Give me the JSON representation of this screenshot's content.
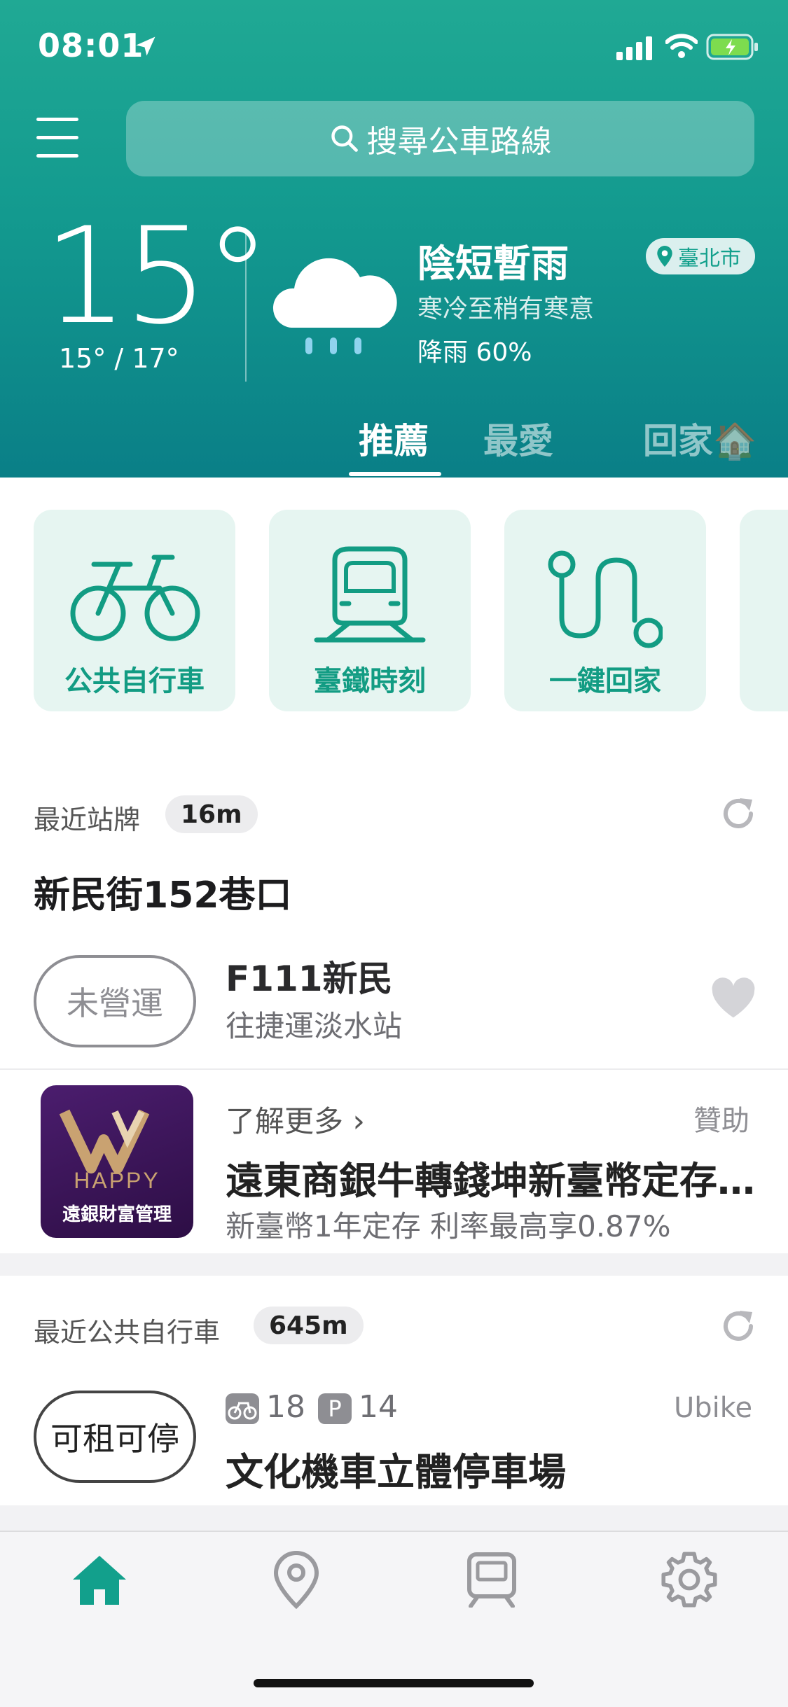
{
  "status_bar": {
    "time": "08:01"
  },
  "search": {
    "placeholder": "搜尋公車路線"
  },
  "weather": {
    "temperature": "15°",
    "range": "15° / 17°",
    "condition": "陰短暫雨",
    "description": "寒冷至稍有寒意",
    "rain": "降雨 60%",
    "location": "臺北市"
  },
  "tabs": [
    {
      "label": "推薦",
      "active": true
    },
    {
      "label": "最愛",
      "active": false
    },
    {
      "label": "回家🏠",
      "active": false
    }
  ],
  "quick_actions": [
    {
      "label": "公共自行車",
      "icon": "bicycle-icon"
    },
    {
      "label": "臺鐵時刻",
      "icon": "train-icon"
    },
    {
      "label": "一鍵回家",
      "icon": "route-icon"
    }
  ],
  "nearest_stop": {
    "section_title": "最近站牌",
    "distance": "16m",
    "stop_name": "新民街152巷口",
    "route": {
      "status": "未營運",
      "name": "F111新民",
      "direction": "往捷運淡水站"
    }
  },
  "ad": {
    "logo_brand": "HAPPY",
    "logo_caption": "遠銀財富管理",
    "link": "了解更多",
    "sponsor": "贊助",
    "title": "遠東商銀牛轉錢坤新臺幣定存…",
    "subtitle": "新臺幣1年定存 利率最高享0.87%"
  },
  "nearest_bike": {
    "section_title": "最近公共自行車",
    "distance": "645m",
    "status": "可租可停",
    "bikes": "18",
    "parking": "14",
    "parking_badge": "P",
    "provider": "Ubike",
    "station": "文化機車立體停車場"
  },
  "colors": {
    "accent": "#12a08c",
    "header_top": "#20a994",
    "header_bottom": "#0a7f87"
  }
}
